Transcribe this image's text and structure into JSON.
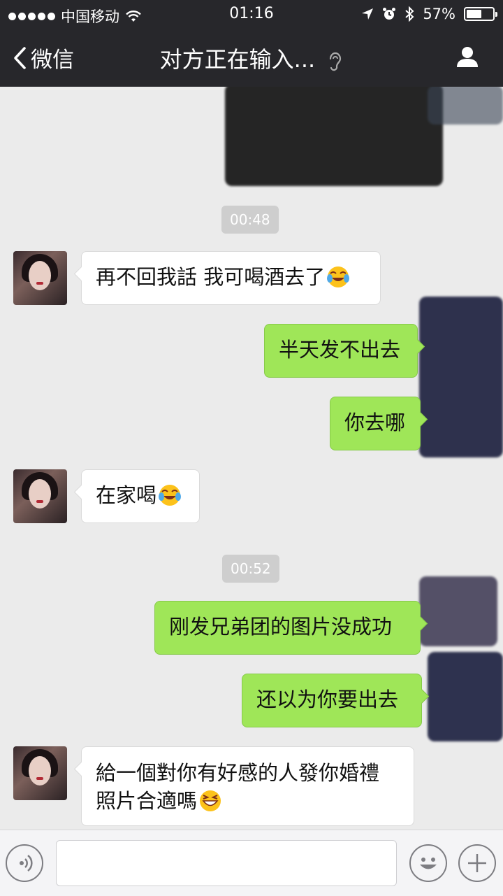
{
  "status_bar": {
    "carrier": "中国移动",
    "time": "01:16",
    "battery": "57%",
    "battery_level": 0.57
  },
  "nav": {
    "back_label": "微信",
    "title": "对方正在输入..."
  },
  "messages": {
    "time_1": "00:48",
    "msg_1": "再不回我話 我可喝酒去了",
    "msg_2": "半天发不出去",
    "msg_3": "你去哪",
    "msg_4": "在家喝",
    "time_2": "00:52",
    "msg_5": "刚发兄弟团的图片没成功",
    "msg_6": "还以为你要出去",
    "msg_7_line1": "給一個對你有好感的人發你婚禮",
    "msg_7_line2": "照片合適嗎"
  },
  "colors": {
    "header_bg": "#27272b",
    "chat_bg": "#ebebeb",
    "outgoing_bubble": "#9fe658",
    "incoming_bubble": "#ffffff"
  },
  "icons": {
    "voice": "voice-icon",
    "emoji": "emoji-icon",
    "plus": "plus-icon",
    "profile": "profile-icon",
    "ear": "ear-icon"
  }
}
